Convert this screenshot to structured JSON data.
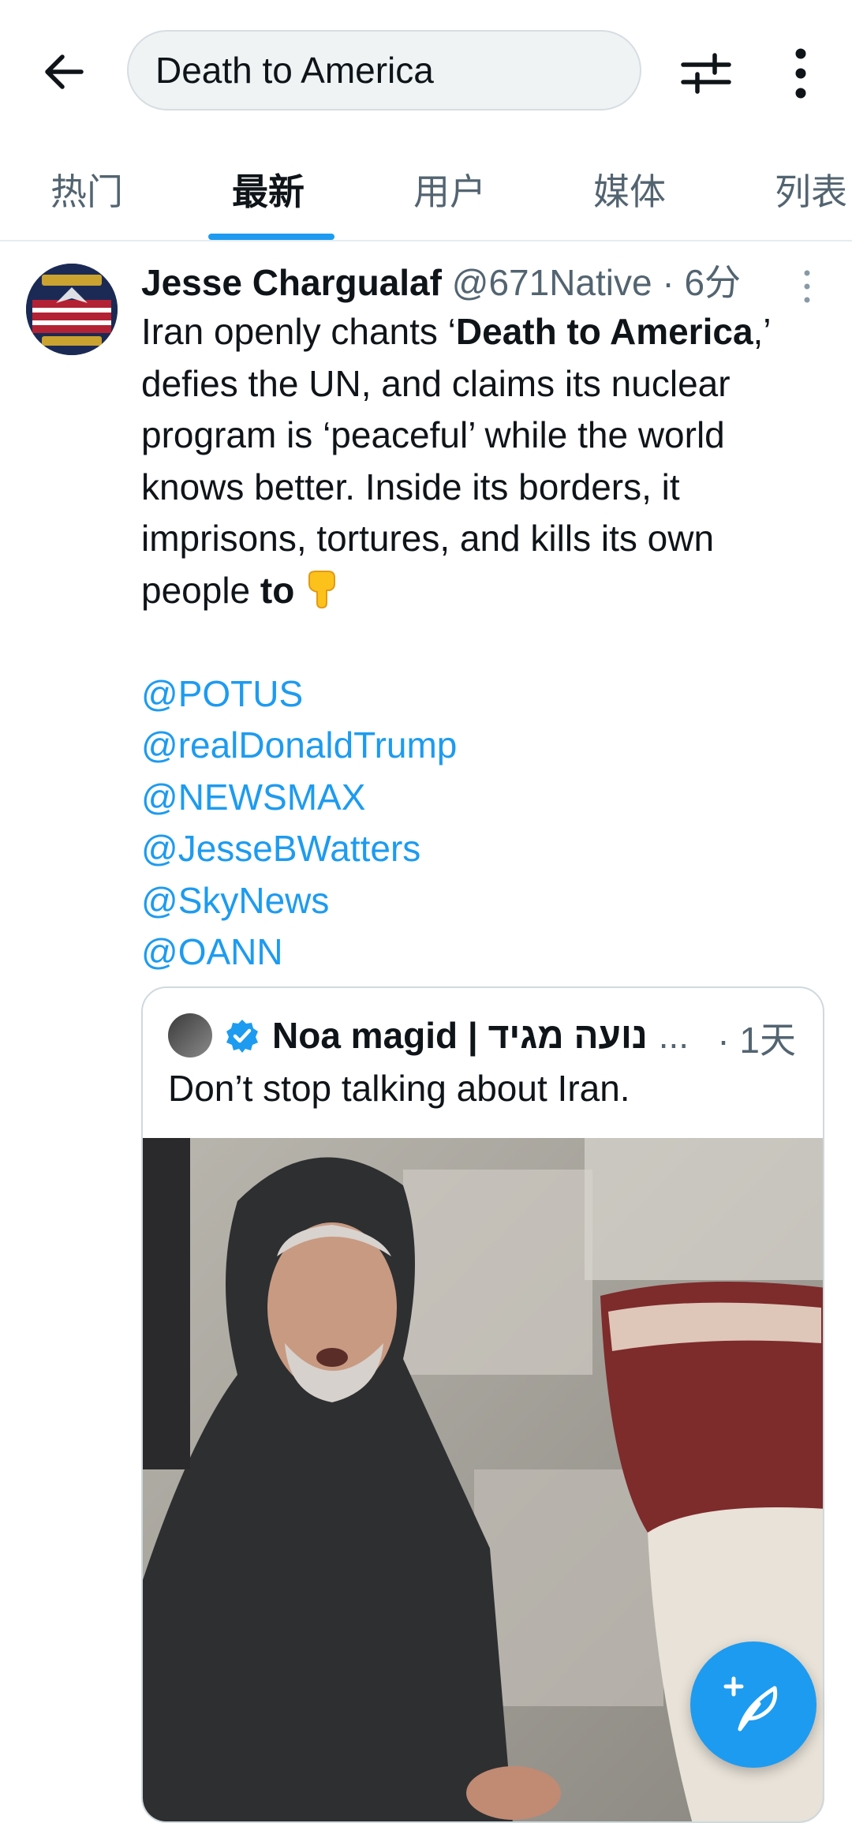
{
  "search": {
    "query": "Death to America"
  },
  "tabs": [
    {
      "label": "热门"
    },
    {
      "label": "最新"
    },
    {
      "label": "用户"
    },
    {
      "label": "媒体"
    },
    {
      "label": "列表"
    }
  ],
  "active_tab_index": 1,
  "tweet": {
    "name": "Jesse Chargualaf",
    "handle": "@671Native",
    "time": "· 6分",
    "text_1": "Iran openly chants ‘",
    "bold_1": "Death to America",
    "text_2": ",’ defies the UN, and claims its nuclear program is ‘peaceful’ while the world knows better. Inside its borders, it imprisons, tortures, and kills its own people ",
    "bold_2": "to",
    "emoji": "backhand-index-pointing-down",
    "mentions": [
      "@POTUS",
      "@realDonaldTrump",
      "@NEWSMAX",
      "@JesseBWatters",
      "@SkyNews",
      "@OANN"
    ]
  },
  "quote": {
    "name": "Noa magid | נועה מגיד",
    "ellipsis": "...",
    "time": "· 1天",
    "text": "Don’t stop talking about Iran.",
    "verified": true
  },
  "colors": {
    "accent": "#1d9bf0",
    "secondary_text": "#536471",
    "text": "#0f1419"
  }
}
